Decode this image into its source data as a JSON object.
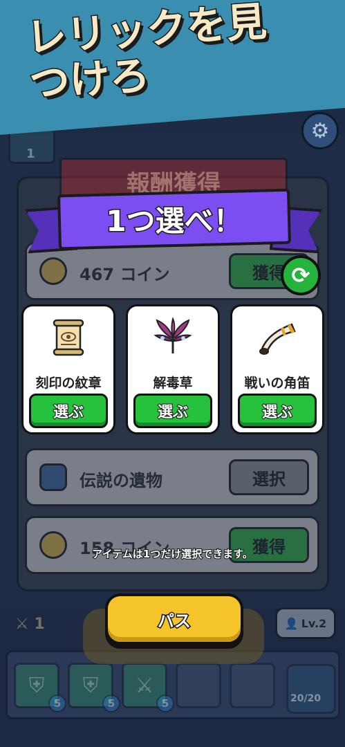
{
  "banner": {
    "title": "レリックを見つけろ",
    "color": "#3a8fb0"
  },
  "header": {
    "slot_count": "1",
    "settings_icon": "gear-icon"
  },
  "background": {
    "reward_title": "報酬獲得",
    "rows": [
      {
        "icon": "coin-icon",
        "label": "467 コイン",
        "button": "獲得"
      },
      {
        "icon": "vase-icon",
        "label": "伝説の遺物",
        "button": "選択"
      },
      {
        "icon": "coin-icon",
        "label": "158 コイン",
        "button": "獲得"
      }
    ]
  },
  "overlay": {
    "title": "1つ選べ！",
    "refresh_icon": "refresh-icon",
    "cards": [
      {
        "icon": "scroll-icon",
        "name": "刻印の紋章",
        "button": "選ぶ"
      },
      {
        "icon": "herb-icon",
        "name": "解毒草",
        "button": "選ぶ"
      },
      {
        "icon": "horn-icon",
        "name": "戦いの角笛",
        "button": "選ぶ"
      }
    ],
    "hint": "アイテムは1つだけ選択できます。",
    "pass_button": "パス"
  },
  "bottom": {
    "sword_count": "1",
    "level": "Lv.2",
    "skills": [
      {
        "icon": "shield-plus-icon",
        "count": "5"
      },
      {
        "icon": "shield-plus-icon",
        "count": "5"
      },
      {
        "icon": "sword-plus-icon",
        "count": "5"
      }
    ],
    "chest_count": "20/20"
  },
  "colors": {
    "accent_green": "#27c23d",
    "ribbon_purple": "#7c4df0",
    "pass_yellow": "#f5c42b"
  }
}
